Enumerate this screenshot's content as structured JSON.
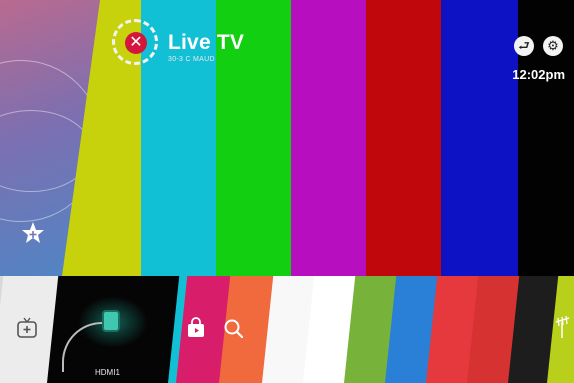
{
  "header": {
    "title": "Live TV",
    "subtitle": "30-3 C MAUD",
    "close_icon": "close-icon",
    "clock": "12:02pm",
    "input_icon": "input-icon",
    "settings_icon": "gear-icon"
  },
  "screen": {
    "color_bars": [
      "#c7d10c",
      "#12c0d6",
      "#12cf12",
      "#b70fbf",
      "#c0070c",
      "#0d12c4",
      "#020202"
    ]
  },
  "sidebar": {
    "favorites_icon": "star-plus-icon"
  },
  "launcher": {
    "add_icon": "tv-plus-icon",
    "hdmi_label": "HDMI1",
    "store_icon": "lg-content-store-icon",
    "search_icon": "search-icon",
    "antenna_icon": "antenna-icon",
    "tile_colors": [
      "#ececec",
      "#050505",
      "#d81d6b",
      "#f06a3d",
      "#f8f8f8",
      "#ffffff",
      "#77b23a",
      "#2a7fd6",
      "#e5393d",
      "#d73232",
      "#1d1d1d",
      "#b8cf1c"
    ]
  },
  "colors": {
    "accent": "#d4163d"
  }
}
